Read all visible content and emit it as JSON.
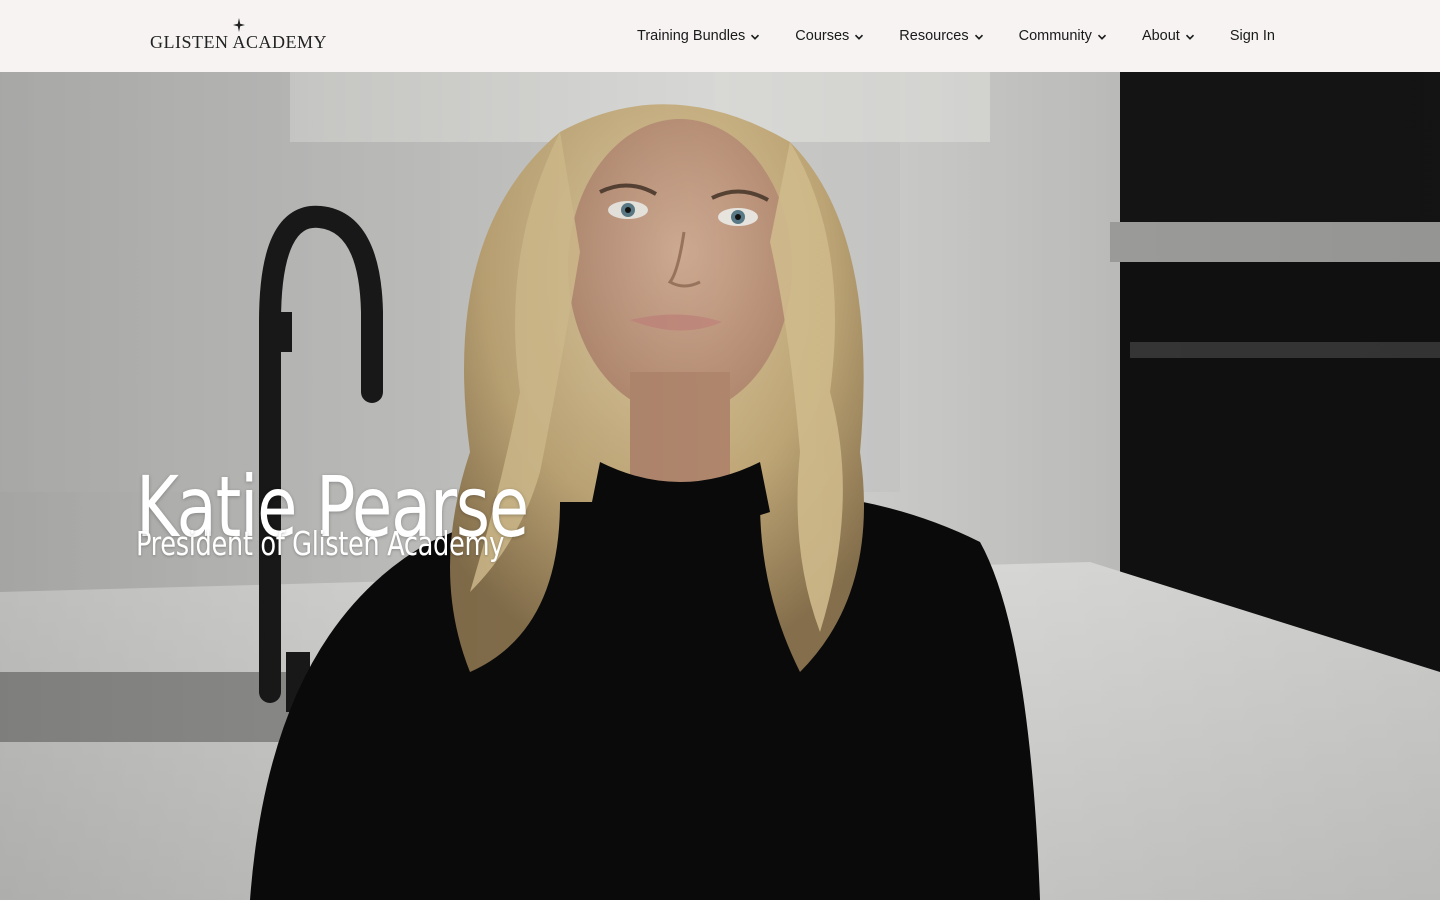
{
  "header": {
    "logo_text": "GLISTEN ACADEMY",
    "nav": [
      {
        "label": "Training Bundles",
        "has_dropdown": true
      },
      {
        "label": "Courses",
        "has_dropdown": true
      },
      {
        "label": "Resources",
        "has_dropdown": true
      },
      {
        "label": "Community",
        "has_dropdown": true
      },
      {
        "label": "About",
        "has_dropdown": true
      }
    ],
    "sign_in": "Sign In",
    "icons": {
      "dropdown": "chevron-down-icon",
      "logo_mark": "sparkle-icon"
    }
  },
  "hero": {
    "title": "Katie Pearse",
    "subtitle": "President of Glisten Academy",
    "image": "portrait-photo"
  },
  "colors": {
    "header_bg": "#f6f3f2",
    "nav_text": "#1a1a1a",
    "hero_text": "#ffffff"
  }
}
